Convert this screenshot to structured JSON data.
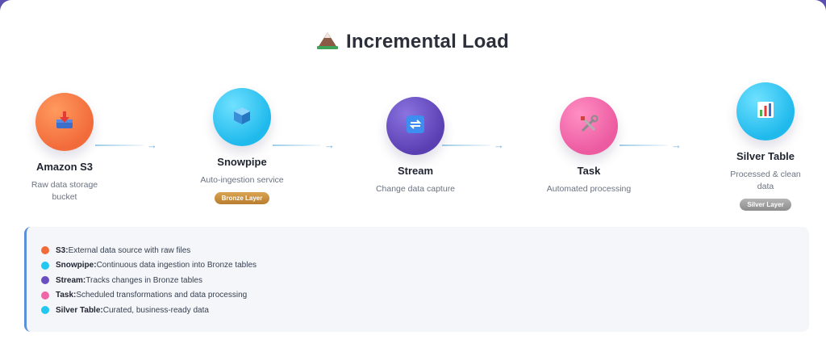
{
  "title": "Incremental Load",
  "steps": [
    {
      "name": "Amazon S3",
      "desc": "Raw data storage bucket",
      "icon": "inbox-download-icon",
      "color": "#f26b3a"
    },
    {
      "name": "Snowpipe",
      "desc": "Auto-ingestion service",
      "badge": "Bronze Layer",
      "icon": "cube-icon",
      "color": "#22c7f2"
    },
    {
      "name": "Stream",
      "desc": "Change data capture",
      "icon": "sync-arrows-icon",
      "color": "#6a4fc0"
    },
    {
      "name": "Task",
      "desc": "Automated processing",
      "icon": "tools-icon",
      "color": "#f064a8"
    },
    {
      "name": "Silver Table",
      "desc": "Processed & clean data",
      "badge": "Silver Layer",
      "icon": "bar-chart-icon",
      "color": "#22c7f2"
    }
  ],
  "colors": {
    "bronze": "#c9903f",
    "silver": "#9e9e9e",
    "legend_accent": "#5a8fd9"
  },
  "arrow_glyph": "→",
  "legend": [
    {
      "label": "S3:",
      "text": "External data source with raw files",
      "color": "#f26b3a"
    },
    {
      "label": "Snowpipe:",
      "text": "Continuous data ingestion into Bronze tables",
      "color": "#22c7f2"
    },
    {
      "label": "Stream:",
      "text": "Tracks changes in Bronze tables",
      "color": "#6a4fc0"
    },
    {
      "label": "Task:",
      "text": "Scheduled transformations and data processing",
      "color": "#f064a8"
    },
    {
      "label": "Silver Table:",
      "text": "Curated, business-ready data",
      "color": "#22c7f2"
    }
  ]
}
